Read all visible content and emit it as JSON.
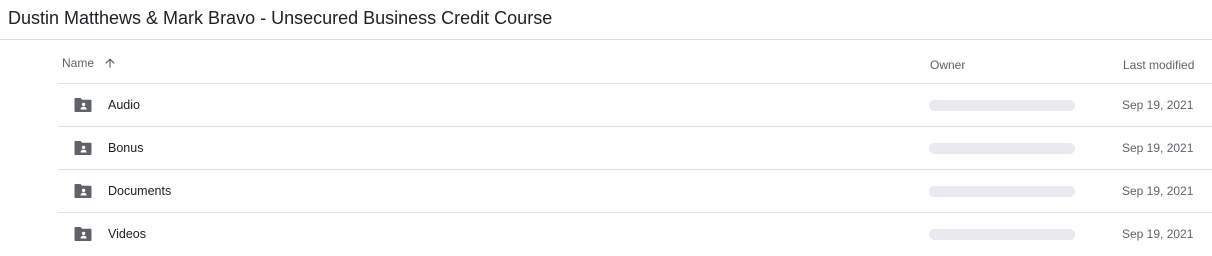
{
  "page": {
    "title": "Dustin Matthews & Mark Bravo - Unsecured Business Credit Course"
  },
  "table": {
    "columns": {
      "name": "Name",
      "owner": "Owner",
      "last_modified": "Last modified"
    },
    "sort": {
      "column": "name",
      "direction": "ascending",
      "icon": "arrow-up-icon"
    },
    "rows": [
      {
        "name": "Audio",
        "icon": "shared-folder-icon",
        "last_modified": "Sep 19, 2021"
      },
      {
        "name": "Bonus",
        "icon": "shared-folder-icon",
        "last_modified": "Sep 19, 2021"
      },
      {
        "name": "Documents",
        "icon": "shared-folder-icon",
        "last_modified": "Sep 19, 2021"
      },
      {
        "name": "Videos",
        "icon": "shared-folder-icon",
        "last_modified": "Sep 19, 2021"
      }
    ]
  },
  "colors": {
    "folder_icon": "#5f6368",
    "owner_placeholder": "#e8eaed",
    "divider": "#e0e0e0",
    "secondary_text": "#5f6368"
  }
}
